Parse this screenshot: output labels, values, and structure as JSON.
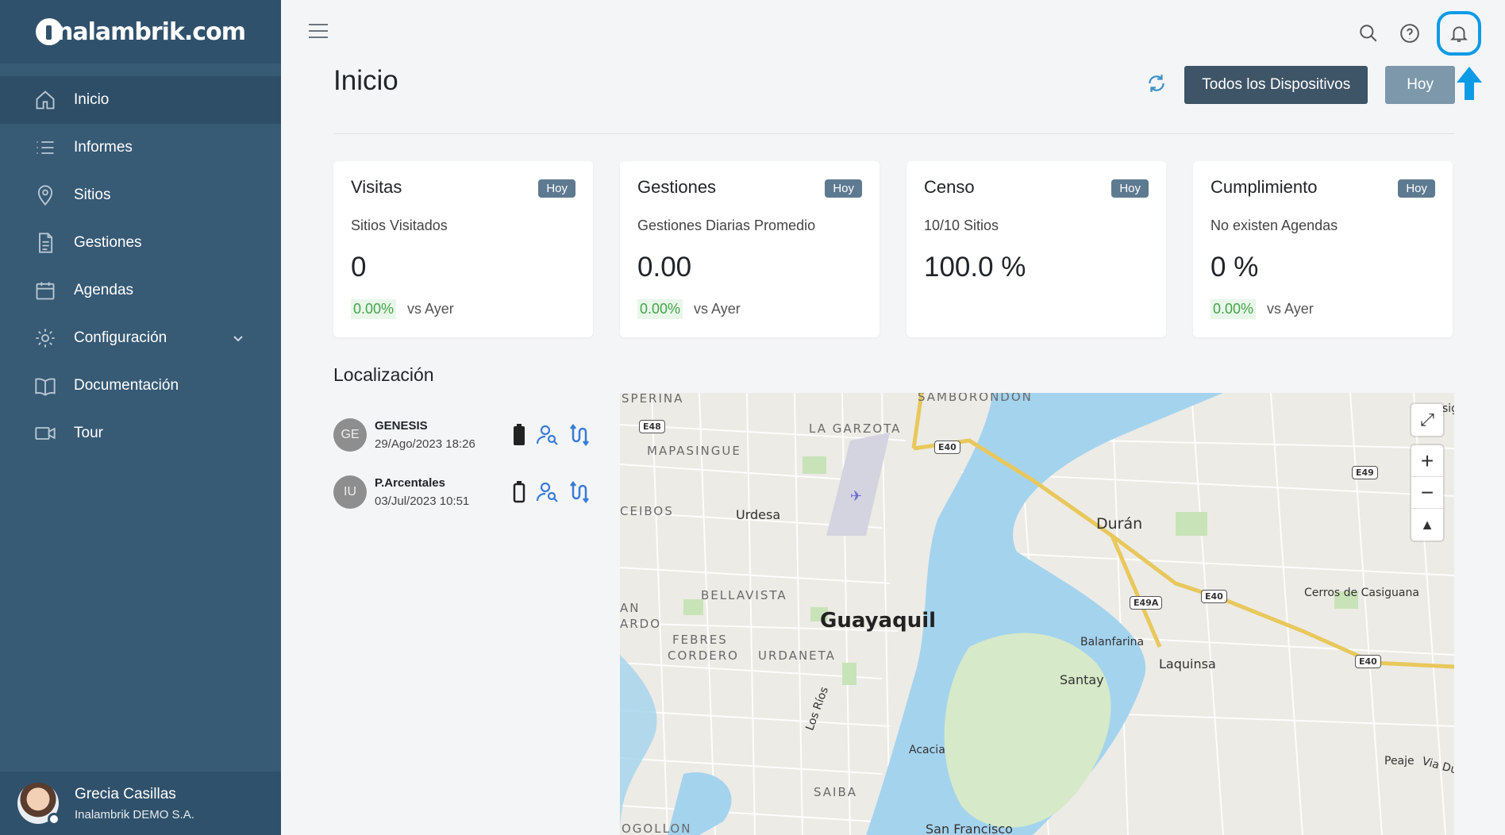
{
  "brand": {
    "logo_text": "nalambrik.com"
  },
  "sidebar": {
    "items": [
      {
        "label": "Inicio",
        "icon": "home-icon"
      },
      {
        "label": "Informes",
        "icon": "list-icon"
      },
      {
        "label": "Sitios",
        "icon": "map-pin-icon"
      },
      {
        "label": "Gestiones",
        "icon": "document-icon"
      },
      {
        "label": "Agendas",
        "icon": "calendar-icon"
      },
      {
        "label": "Configuración",
        "icon": "gear-icon"
      },
      {
        "label": "Documentación",
        "icon": "book-icon"
      },
      {
        "label": "Tour",
        "icon": "video-camera-icon"
      }
    ]
  },
  "user": {
    "name": "Grecia Casillas",
    "org": "Inalambrik DEMO S.A."
  },
  "header": {
    "title": "Inicio",
    "devices_button": "Todos los Dispositivos",
    "period_button": "Hoy"
  },
  "cards": [
    {
      "title": "Visitas",
      "badge": "Hoy",
      "sub": "Sitios Visitados",
      "value": "0",
      "delta": "0.00%",
      "compare": "vs Ayer"
    },
    {
      "title": "Gestiones",
      "badge": "Hoy",
      "sub": "Gestiones Diarias Promedio",
      "value": "0.00",
      "delta": "0.00%",
      "compare": "vs Ayer"
    },
    {
      "title": "Censo",
      "badge": "Hoy",
      "sub": "10/10 Sitios",
      "value": "100.0 %"
    },
    {
      "title": "Cumplimiento",
      "badge": "Hoy",
      "sub": "No existen Agendas",
      "value": "0 %",
      "delta": "0.00%",
      "compare": "vs Ayer"
    }
  ],
  "location": {
    "title": "Localización",
    "devices": [
      {
        "initials": "GE",
        "name": "GENESIS",
        "date": "29/Ago/2023 18:26",
        "battery": "full"
      },
      {
        "initials": "IU",
        "name": "P.Arcentales",
        "date": "03/Jul/2023 10:51",
        "battery": "empty"
      }
    ]
  },
  "map": {
    "labels": {
      "sperina": "SPERINA",
      "samborondon": "SAMBORONDON",
      "garzota": "LA GARZOTA",
      "mapasingue": "MAPASINGUE",
      "ceibos": "CEIBOS",
      "urdesa": "Urdesa",
      "duran": "Durán",
      "bellavista": "BELLAVISTA",
      "guayaquil": "Guayaquil",
      "febres": "FEBRES",
      "cordero": "CORDERO",
      "urdaneta": "URDANETA",
      "an": "AN",
      "ardo": "ARDO",
      "cerros": "Cerros de Casiguana",
      "balanfarina": "Balanfarina",
      "laquinsa": "Laquinsa",
      "santay": "Santay",
      "losrios": "Los Ríos",
      "acacia": "Acacia",
      "saiba": "SAIBA",
      "peaje": "Peaje",
      "viadu": "Via Du",
      "ogollon": "OGOLLON",
      "sanfrancisco": "San Francisco",
      "sig": "sig"
    },
    "shields": {
      "e48": "E48",
      "e40a": "E40",
      "e49": "E49",
      "e49a": "E49A",
      "e40b": "E40",
      "e40c": "E40"
    }
  },
  "colors": {
    "sidebar": "#375a75",
    "accent": "#0d9be6",
    "positive": "#43a548",
    "water": "#a4d3ee"
  }
}
